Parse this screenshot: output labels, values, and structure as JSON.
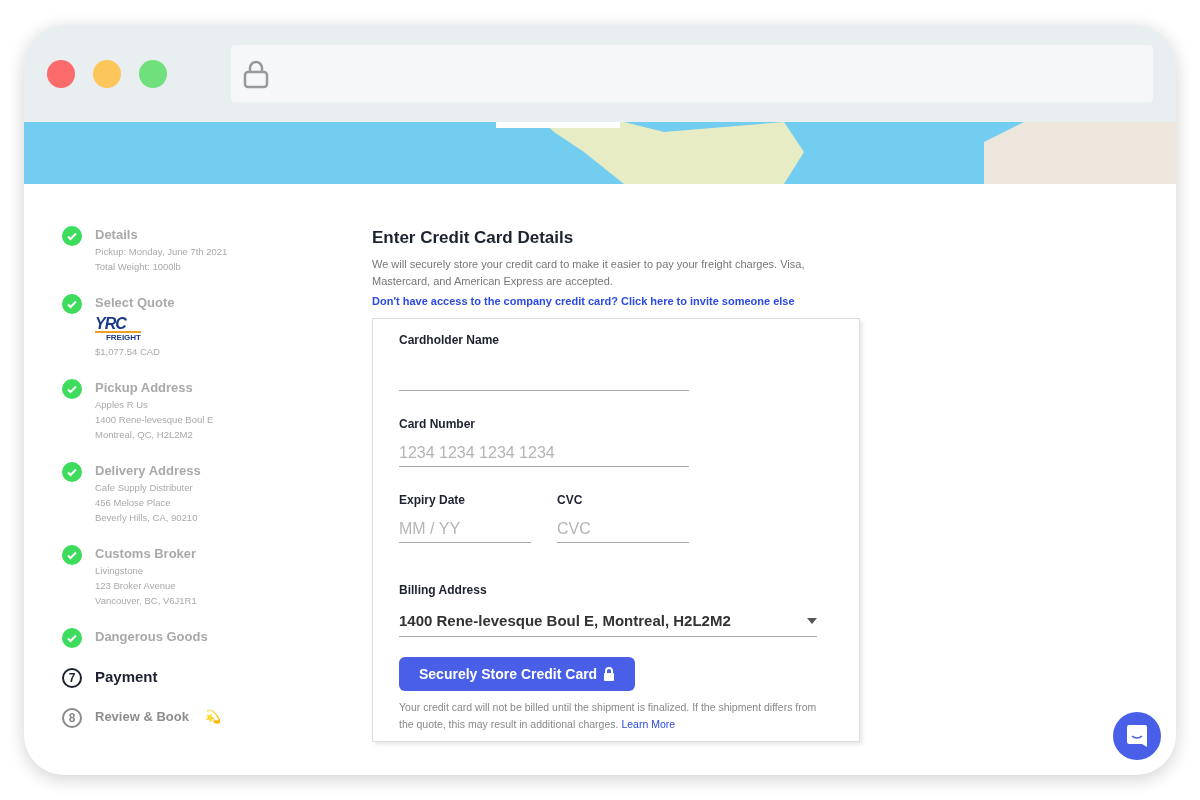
{
  "browser": {
    "traffic_lights": [
      {
        "color": "#fc6b6b"
      },
      {
        "color": "#fdc65b"
      },
      {
        "color": "#6fe07b"
      }
    ]
  },
  "steps": [
    {
      "kind": "done",
      "title": "Details",
      "lines": [
        "Pickup: Monday, June 7th 2021",
        "Total Weight: 1000lb"
      ]
    },
    {
      "kind": "done",
      "title": "Select Quote",
      "logo": {
        "text": "YRC",
        "subtext": "FREIGHT"
      },
      "lines": [
        "$1,077.54 CAD"
      ]
    },
    {
      "kind": "done",
      "title": "Pickup Address",
      "lines": [
        "Apples R Us",
        "1400 Rene-levesque Boul E",
        "Montreal, QC, H2L2M2"
      ]
    },
    {
      "kind": "done",
      "title": "Delivery Address",
      "lines": [
        "Cafe Supply Distributer",
        "456 Melose Place",
        "Beverly Hills, CA, 90210"
      ]
    },
    {
      "kind": "done",
      "title": "Customs Broker",
      "lines": [
        "Livingstone",
        "123 Broker Avenue",
        "Vancouver, BC, V6J1R1"
      ]
    },
    {
      "kind": "done",
      "title": "Dangerous Goods"
    },
    {
      "kind": "current",
      "number": "7",
      "title": "Payment"
    },
    {
      "kind": "pending",
      "number": "8",
      "title": "Review & Book",
      "emoji": "💫"
    }
  ],
  "form": {
    "title": "Enter Credit Card Details",
    "intro": "We will securely store your credit card to make it easier to pay your freight charges. Visa, Mastercard, and American Express are accepted.",
    "invite_link": "Don't have access to the company credit card? Click here to invite someone else",
    "cardholder": {
      "label": "Cardholder Name"
    },
    "card_number": {
      "label": "Card Number",
      "placeholder": "1234 1234 1234 1234"
    },
    "expiry": {
      "label": "Expiry Date",
      "placeholder": "MM / YY"
    },
    "cvc": {
      "label": "CVC",
      "placeholder": "CVC"
    },
    "billing": {
      "label": "Billing Address",
      "value": "1400 Rene-levesque Boul E, Montreal, H2L2M2"
    },
    "submit": "Securely Store Credit Card",
    "note": "Your credit card will not be billed until the shipment is finalized. If the shipment differs from the quote, this may result in additional charges.",
    "learn_more": "Learn More"
  }
}
